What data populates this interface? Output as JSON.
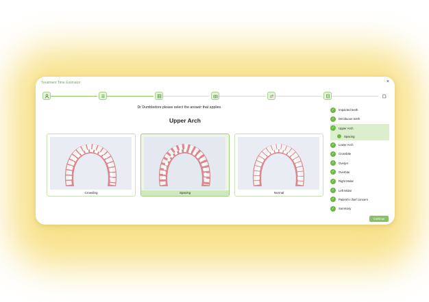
{
  "modal": {
    "title": "Treatment Time Estimator",
    "close": "×"
  },
  "prompt": "Dr Dumbledore please select the answer that applies.",
  "arch_title": "Upper Arch",
  "options": [
    {
      "label": "Crowding",
      "selected": false
    },
    {
      "label": "Spacing",
      "selected": true
    },
    {
      "label": "Normal",
      "selected": false
    }
  ],
  "sidebar": {
    "items": [
      {
        "label": "Impacted teeth"
      },
      {
        "label": "Deciduous teeth"
      },
      {
        "label": "Upper Arch",
        "sub": "Spacing"
      },
      {
        "label": "Lower Arch"
      },
      {
        "label": "Crossbite"
      },
      {
        "label": "Overjet"
      },
      {
        "label": "Overbite"
      },
      {
        "label": "Right Molar"
      },
      {
        "label": "Left Molar"
      },
      {
        "label": "Patient's chief concern"
      },
      {
        "label": "Summary"
      }
    ]
  },
  "continue_label": "Continue",
  "colors": {
    "accent": "#6db846",
    "glow": "#f7dd78"
  }
}
